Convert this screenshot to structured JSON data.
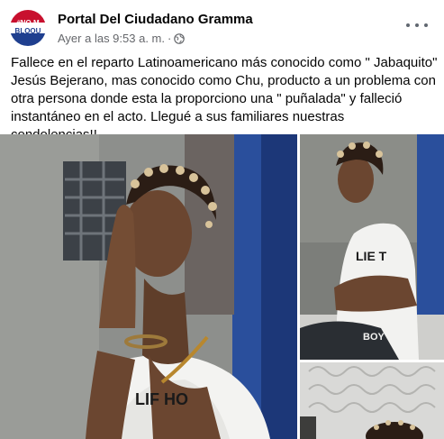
{
  "post": {
    "author": {
      "name": "Portal Del Ciudadano Gramma",
      "avatar_text_lines": [
        "#NO M",
        "BLOQU"
      ]
    },
    "timestamp": "Ayer a las 9:53 a. m.",
    "separator": "·",
    "privacy_icon": "globe-icon",
    "more_icon": "more-options-icon",
    "text": "Fallece en el reparto Latinoamericano más conocido como \" Jabaquito\" Jesús Bejerano, mas conocido como Chu, producto a un problema con otra persona donde esta la proporciono una \" puñalada\" y falleció instantáneo en el acto. Llegué a sus familiares nuestras condolencias!!.",
    "photos": [
      {
        "name": "photo-praying",
        "shirt_text": "LIF HO"
      },
      {
        "name": "photo-sitting",
        "shirt_text": "LIE T",
        "shorts_text": "BOY"
      },
      {
        "name": "photo-third"
      }
    ]
  },
  "colors": {
    "text_primary": "#050505",
    "text_secondary": "#65676b",
    "avatar_red": "#c8102e",
    "avatar_blue": "#1f3f8f"
  }
}
